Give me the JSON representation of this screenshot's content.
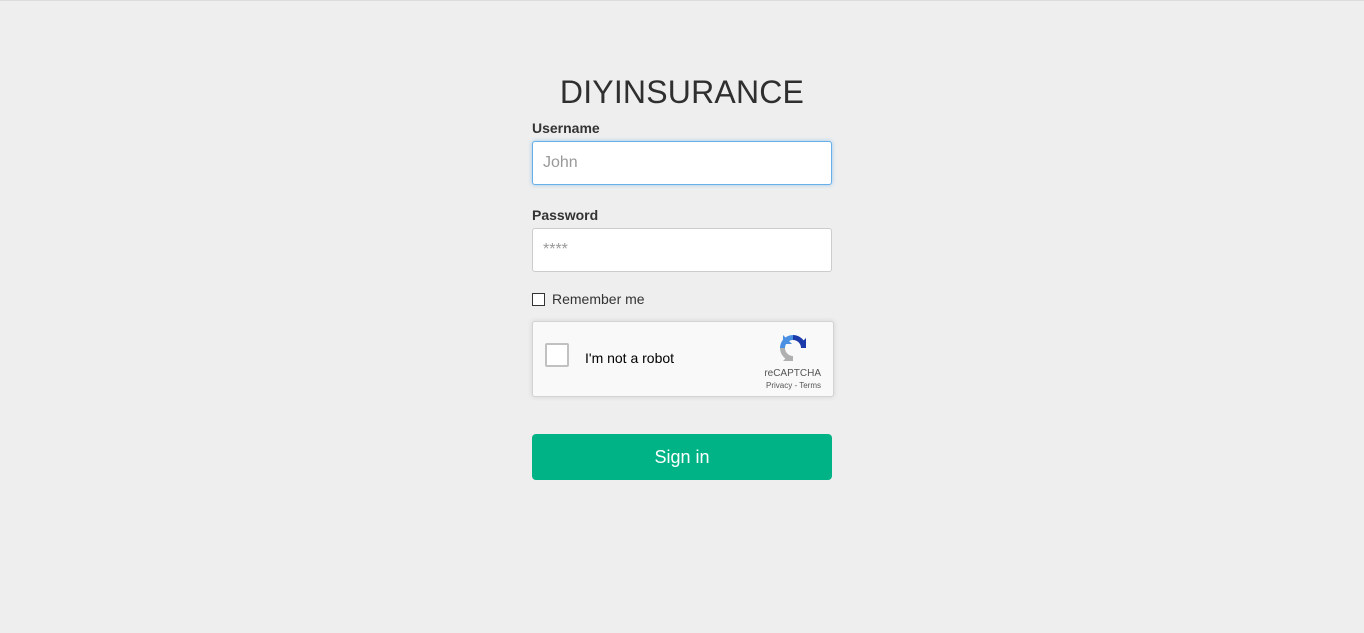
{
  "brand": {
    "title": "DIYINSURANCE"
  },
  "form": {
    "username_label": "Username",
    "username_placeholder": "John",
    "password_label": "Password",
    "password_placeholder": "****",
    "remember_label": "Remember me",
    "signin_label": "Sign in"
  },
  "recaptcha": {
    "label": "I'm not a robot",
    "brand": "reCAPTCHA",
    "privacy": "Privacy",
    "separator": " - ",
    "terms": "Terms",
    "icon": "recaptcha-logo-icon"
  },
  "colors": {
    "background": "#eeeeee",
    "button": "#00b386",
    "focus_border": "#66afe9"
  }
}
